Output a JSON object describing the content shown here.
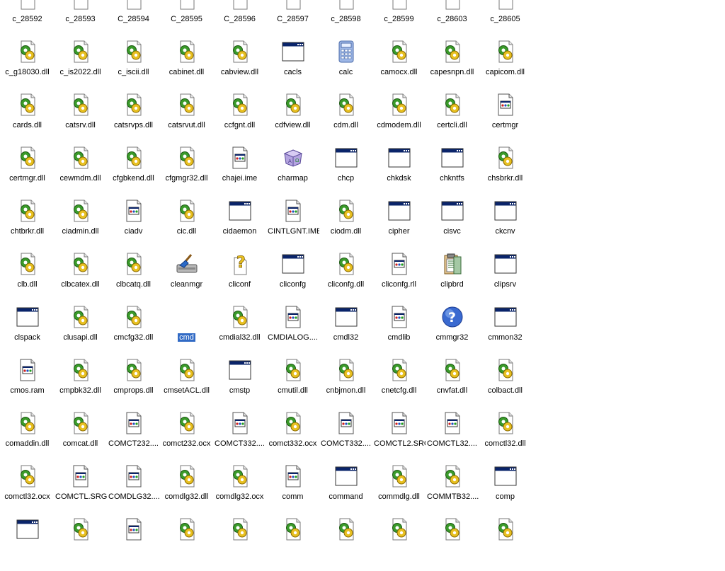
{
  "files": [
    {
      "name": "c_28592",
      "icon": "generic-file-icon"
    },
    {
      "name": "c_28593",
      "icon": "generic-file-icon"
    },
    {
      "name": "C_28594",
      "icon": "generic-file-icon"
    },
    {
      "name": "C_28595",
      "icon": "generic-file-icon"
    },
    {
      "name": "C_28596",
      "icon": "generic-file-icon"
    },
    {
      "name": "C_28597",
      "icon": "generic-file-icon"
    },
    {
      "name": "c_28598",
      "icon": "generic-file-icon"
    },
    {
      "name": "c_28599",
      "icon": "generic-file-icon"
    },
    {
      "name": "c_28603",
      "icon": "generic-file-icon"
    },
    {
      "name": "c_28605",
      "icon": "generic-file-icon"
    },
    {
      "name": "c_g18030.dll",
      "icon": "dll-file-icon"
    },
    {
      "name": "c_is2022.dll",
      "icon": "dll-file-icon"
    },
    {
      "name": "c_iscii.dll",
      "icon": "dll-file-icon"
    },
    {
      "name": "cabinet.dll",
      "icon": "dll-file-icon"
    },
    {
      "name": "cabview.dll",
      "icon": "dll-file-icon"
    },
    {
      "name": "cacls",
      "icon": "application-window-icon"
    },
    {
      "name": "calc",
      "icon": "calculator-icon"
    },
    {
      "name": "camocx.dll",
      "icon": "dll-file-icon"
    },
    {
      "name": "capesnpn.dll",
      "icon": "dll-file-icon"
    },
    {
      "name": "capicom.dll",
      "icon": "dll-file-icon"
    },
    {
      "name": "cards.dll",
      "icon": "dll-file-icon"
    },
    {
      "name": "catsrv.dll",
      "icon": "dll-file-icon"
    },
    {
      "name": "catsrvps.dll",
      "icon": "dll-file-icon"
    },
    {
      "name": "catsrvut.dll",
      "icon": "dll-file-icon"
    },
    {
      "name": "ccfgnt.dll",
      "icon": "dll-file-icon"
    },
    {
      "name": "cdfview.dll",
      "icon": "dll-file-icon"
    },
    {
      "name": "cdm.dll",
      "icon": "dll-file-icon"
    },
    {
      "name": "cdmodem.dll",
      "icon": "dll-file-icon"
    },
    {
      "name": "certcli.dll",
      "icon": "dll-file-icon"
    },
    {
      "name": "certmgr",
      "icon": "system-file-icon"
    },
    {
      "name": "certmgr.dll",
      "icon": "dll-file-icon"
    },
    {
      "name": "cewmdm.dll",
      "icon": "dll-file-icon"
    },
    {
      "name": "cfgbkend.dll",
      "icon": "dll-file-icon"
    },
    {
      "name": "cfgmgr32.dll",
      "icon": "dll-file-icon"
    },
    {
      "name": "chajei.ime",
      "icon": "system-file-icon"
    },
    {
      "name": "charmap",
      "icon": "charmap-icon"
    },
    {
      "name": "chcp",
      "icon": "application-window-icon"
    },
    {
      "name": "chkdsk",
      "icon": "application-window-icon"
    },
    {
      "name": "chkntfs",
      "icon": "application-window-icon"
    },
    {
      "name": "chsbrkr.dll",
      "icon": "dll-file-icon"
    },
    {
      "name": "chtbrkr.dll",
      "icon": "dll-file-icon"
    },
    {
      "name": "ciadmin.dll",
      "icon": "dll-file-icon"
    },
    {
      "name": "ciadv",
      "icon": "system-file-icon"
    },
    {
      "name": "cic.dll",
      "icon": "dll-file-icon"
    },
    {
      "name": "cidaemon",
      "icon": "application-window-icon"
    },
    {
      "name": "CINTLGNT.IME",
      "icon": "system-file-icon"
    },
    {
      "name": "ciodm.dll",
      "icon": "dll-file-icon"
    },
    {
      "name": "cipher",
      "icon": "application-window-icon"
    },
    {
      "name": "cisvc",
      "icon": "application-window-icon"
    },
    {
      "name": "ckcnv",
      "icon": "application-window-icon"
    },
    {
      "name": "clb.dll",
      "icon": "dll-file-icon"
    },
    {
      "name": "clbcatex.dll",
      "icon": "dll-file-icon"
    },
    {
      "name": "clbcatq.dll",
      "icon": "dll-file-icon"
    },
    {
      "name": "cleanmgr",
      "icon": "cleanmgr-icon"
    },
    {
      "name": "cliconf",
      "icon": "help-file-icon"
    },
    {
      "name": "cliconfg",
      "icon": "application-window-icon"
    },
    {
      "name": "cliconfg.dll",
      "icon": "dll-file-icon"
    },
    {
      "name": "cliconfg.rll",
      "icon": "system-file-icon"
    },
    {
      "name": "clipbrd",
      "icon": "clipbrd-icon"
    },
    {
      "name": "clipsrv",
      "icon": "application-window-icon"
    },
    {
      "name": "clspack",
      "icon": "application-window-icon"
    },
    {
      "name": "clusapi.dll",
      "icon": "dll-file-icon"
    },
    {
      "name": "cmcfg32.dll",
      "icon": "dll-file-icon"
    },
    {
      "name": "cmd",
      "icon": "blank-icon",
      "selected": true
    },
    {
      "name": "cmdial32.dll",
      "icon": "dll-file-icon"
    },
    {
      "name": "CMDIALOG....",
      "icon": "system-file-icon"
    },
    {
      "name": "cmdl32",
      "icon": "application-window-icon"
    },
    {
      "name": "cmdlib",
      "icon": "system-file-icon"
    },
    {
      "name": "cmmgr32",
      "icon": "question-icon"
    },
    {
      "name": "cmmon32",
      "icon": "application-window-icon"
    },
    {
      "name": "cmos.ram",
      "icon": "system-file-icon"
    },
    {
      "name": "cmpbk32.dll",
      "icon": "dll-file-icon"
    },
    {
      "name": "cmprops.dll",
      "icon": "dll-file-icon"
    },
    {
      "name": "cmsetACL.dll",
      "icon": "dll-file-icon"
    },
    {
      "name": "cmstp",
      "icon": "application-window-icon"
    },
    {
      "name": "cmutil.dll",
      "icon": "dll-file-icon"
    },
    {
      "name": "cnbjmon.dll",
      "icon": "dll-file-icon"
    },
    {
      "name": "cnetcfg.dll",
      "icon": "dll-file-icon"
    },
    {
      "name": "cnvfat.dll",
      "icon": "dll-file-icon"
    },
    {
      "name": "colbact.dll",
      "icon": "dll-file-icon"
    },
    {
      "name": "comaddin.dll",
      "icon": "dll-file-icon"
    },
    {
      "name": "comcat.dll",
      "icon": "dll-file-icon"
    },
    {
      "name": "COMCT232....",
      "icon": "system-file-icon"
    },
    {
      "name": "comct232.ocx",
      "icon": "dll-file-icon"
    },
    {
      "name": "COMCT332....",
      "icon": "system-file-icon"
    },
    {
      "name": "comct332.ocx",
      "icon": "dll-file-icon"
    },
    {
      "name": "COMCT332....",
      "icon": "system-file-icon"
    },
    {
      "name": "COMCTL2.SRG",
      "icon": "system-file-icon"
    },
    {
      "name": "COMCTL32....",
      "icon": "system-file-icon"
    },
    {
      "name": "comctl32.dll",
      "icon": "dll-file-icon"
    },
    {
      "name": "comctl32.ocx",
      "icon": "dll-file-icon"
    },
    {
      "name": "COMCTL.SRG",
      "icon": "system-file-icon"
    },
    {
      "name": "COMDLG32....",
      "icon": "system-file-icon"
    },
    {
      "name": "comdlg32.dll",
      "icon": "dll-file-icon"
    },
    {
      "name": "comdlg32.ocx",
      "icon": "dll-file-icon"
    },
    {
      "name": "comm",
      "icon": "system-file-icon"
    },
    {
      "name": "command",
      "icon": "application-window-icon"
    },
    {
      "name": "commdlg.dll",
      "icon": "dll-file-icon"
    },
    {
      "name": "COMMTB32....",
      "icon": "dll-file-icon"
    },
    {
      "name": "comp",
      "icon": "application-window-icon"
    },
    {
      "name": "",
      "icon": "application-window-icon"
    },
    {
      "name": "",
      "icon": "dll-file-icon"
    },
    {
      "name": "",
      "icon": "system-file-icon"
    },
    {
      "name": "",
      "icon": "dll-file-icon"
    },
    {
      "name": "",
      "icon": "dll-file-icon"
    },
    {
      "name": "",
      "icon": "dll-file-icon"
    },
    {
      "name": "",
      "icon": "dll-file-icon"
    },
    {
      "name": "",
      "icon": "dll-file-icon"
    },
    {
      "name": "",
      "icon": "dll-file-icon"
    },
    {
      "name": "",
      "icon": "dll-file-icon"
    }
  ],
  "colors": {
    "selection": "#316ac5",
    "window_title_blue": "#0a246a",
    "gear_green": "#3a9a2a",
    "gear_yellow": "#e8c020"
  }
}
